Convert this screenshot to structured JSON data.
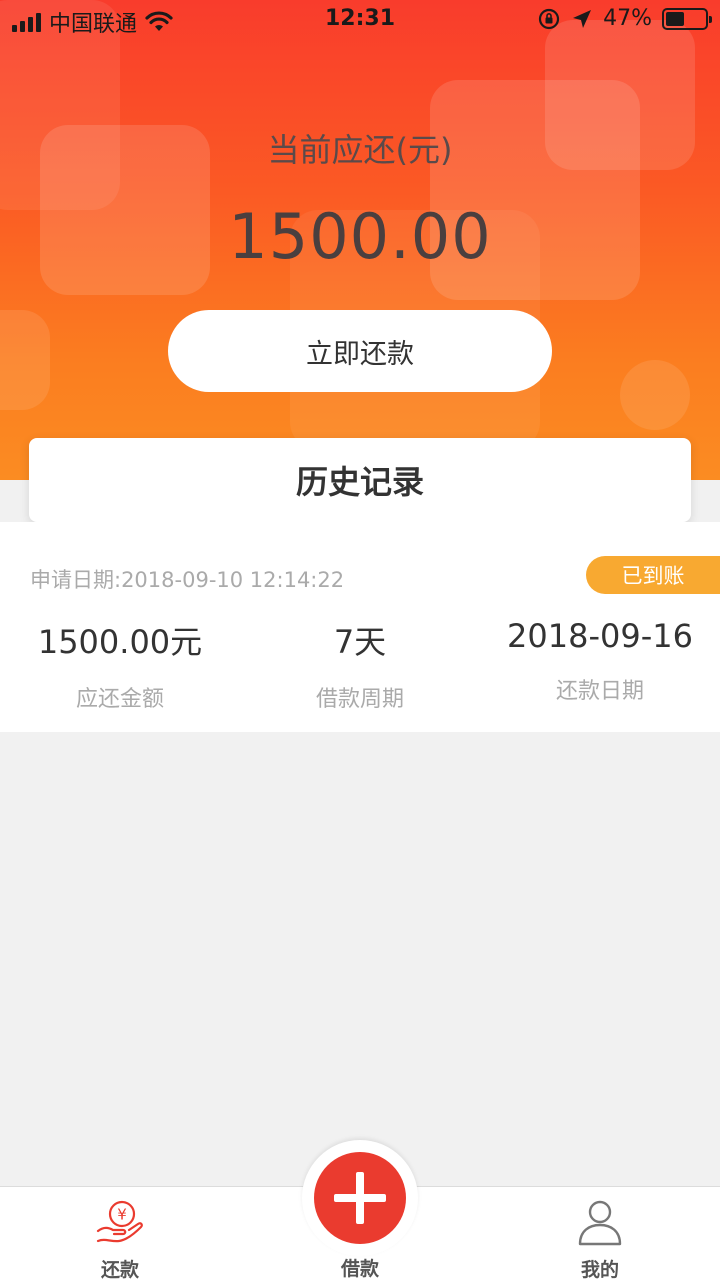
{
  "status_bar": {
    "carrier": "中国联通",
    "time": "12:31",
    "battery": "47%",
    "battery_level": 0.47
  },
  "summary": {
    "label": "当前应还(元)",
    "amount": "1500.00",
    "repay_button": "立即还款"
  },
  "history": {
    "title": "历史记录",
    "records": [
      {
        "apply_date": "申请日期:2018-09-10 12:14:22",
        "status": "已到账",
        "amount": "1500.00元",
        "amount_label": "应还金额",
        "period": "7天",
        "period_label": "借款周期",
        "repay_date": "2018-09-16",
        "repay_date_label": "还款日期"
      }
    ]
  },
  "tabbar": {
    "tabs": [
      {
        "label": "还款",
        "icon": "repay-yen-hand-icon"
      },
      {
        "label": "借款",
        "icon": "plus-icon"
      },
      {
        "label": "我的",
        "icon": "user-icon"
      }
    ]
  },
  "colors": {
    "accent": "#ea3b2f",
    "badge": "#f8a931",
    "gradient_top": "#f93c2c",
    "gradient_bottom": "#fb8c22"
  }
}
